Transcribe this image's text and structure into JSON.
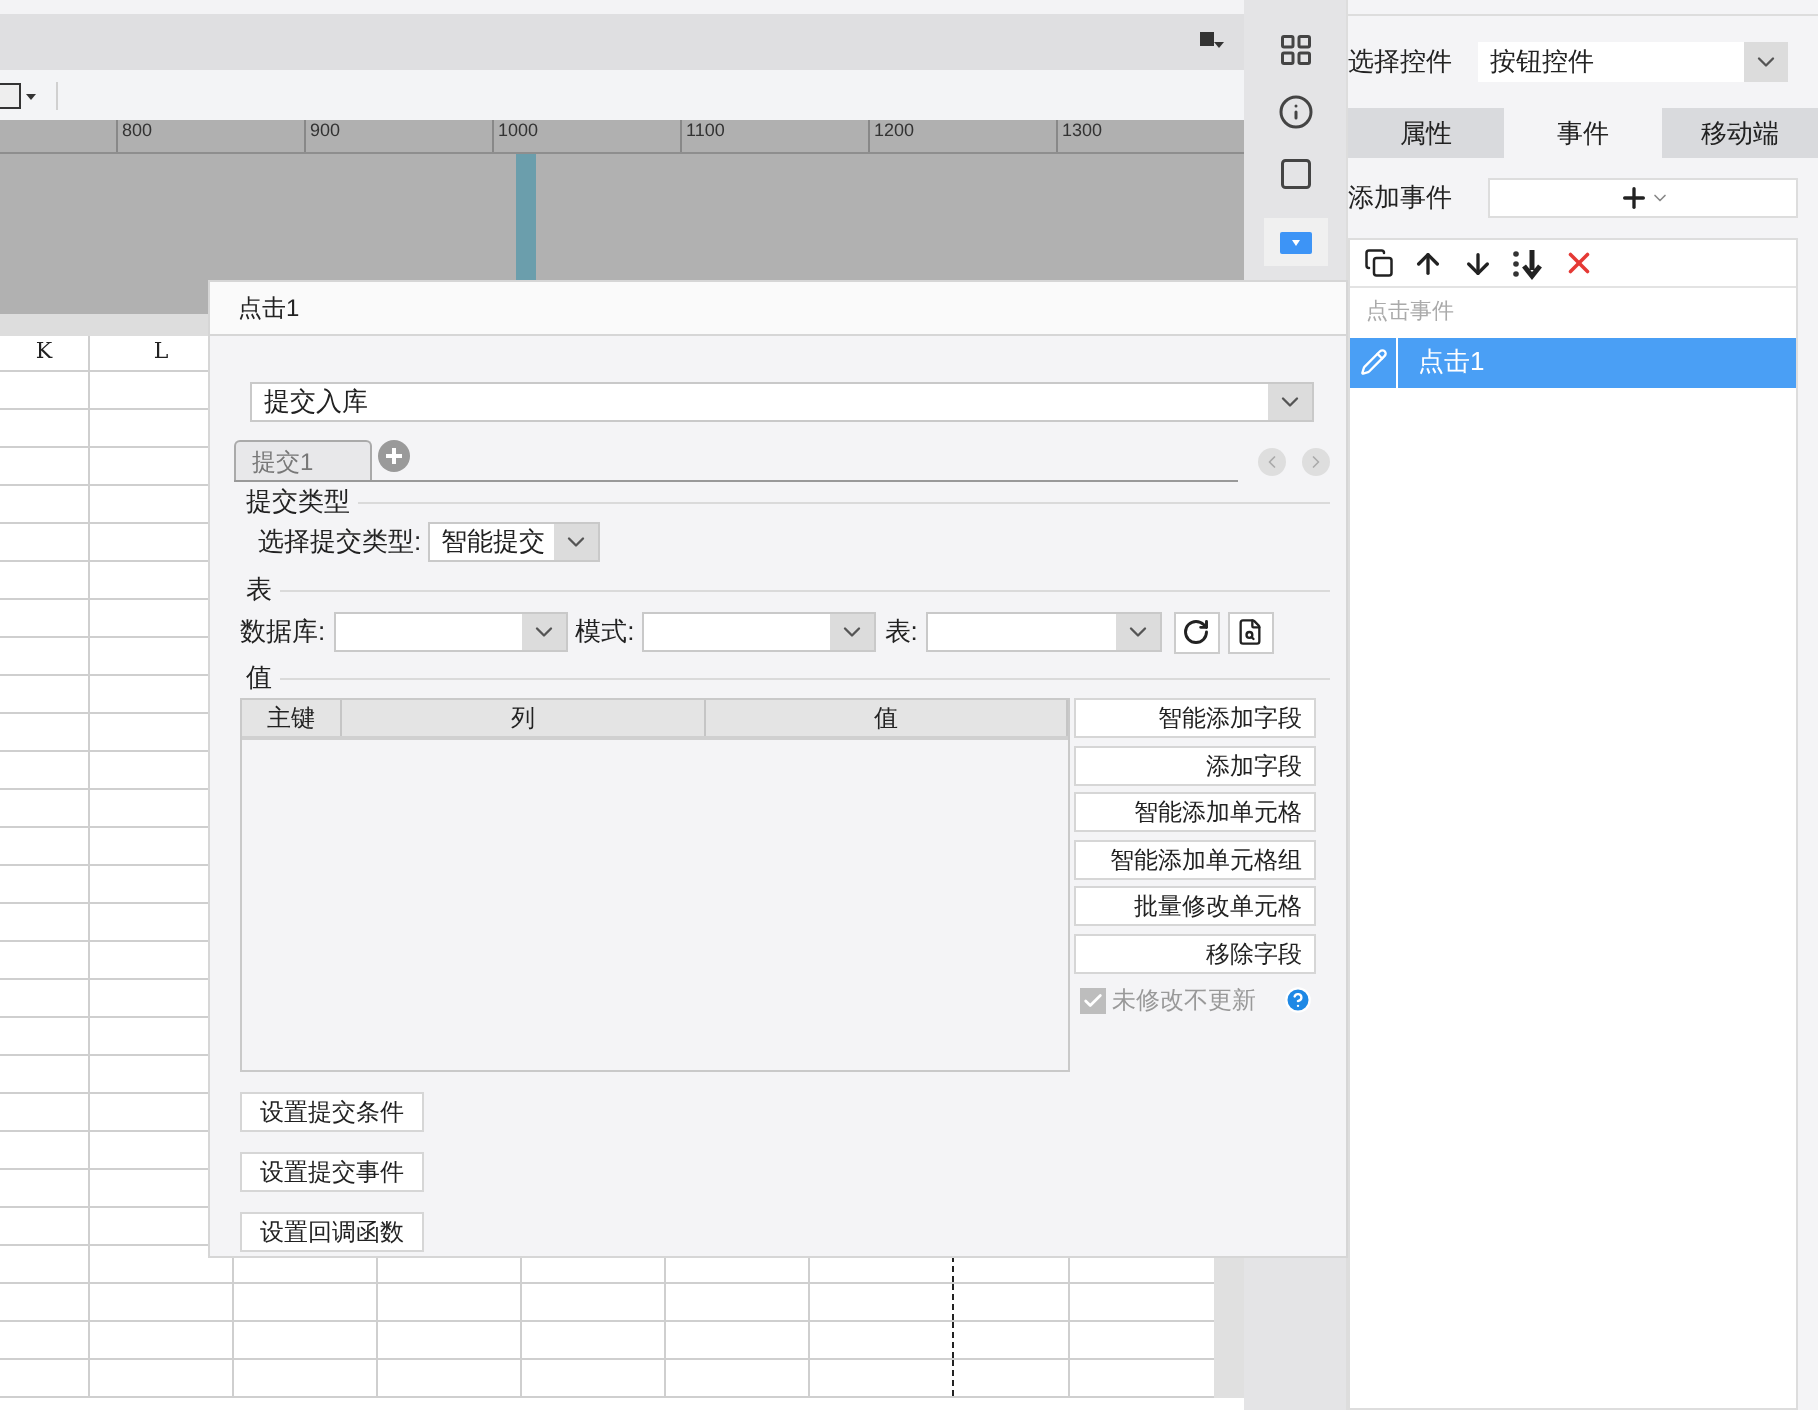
{
  "ruler": {
    "labels": [
      "800",
      "900",
      "1000",
      "1100",
      "1200",
      "1300"
    ]
  },
  "sheet": {
    "columns": [
      "K",
      "L"
    ]
  },
  "right_panel": {
    "control_select": {
      "label": "选择控件",
      "value": "按钮控件"
    },
    "tabs": [
      {
        "label": "属性",
        "selected": false
      },
      {
        "label": "事件",
        "selected": true
      },
      {
        "label": "移动端",
        "selected": false
      }
    ],
    "add_event": {
      "label": "添加事件"
    },
    "event_list": {
      "header": "点击事件",
      "items": [
        {
          "label": "点击1",
          "selected": true
        }
      ]
    }
  },
  "dialog": {
    "title": "点击1",
    "action_select": {
      "value": "提交入库"
    },
    "tabs": [
      {
        "label": "提交1",
        "selected": true
      }
    ],
    "submit_type": {
      "heading": "提交类型",
      "label": "选择提交类型:",
      "value": "智能提交"
    },
    "table_section": {
      "heading": "表",
      "fields": [
        {
          "label": "数据库:"
        },
        {
          "label": "模式:"
        },
        {
          "label": "表:"
        }
      ]
    },
    "values": {
      "heading": "值",
      "columns": [
        "主键",
        "列",
        "值"
      ],
      "buttons": [
        "智能添加字段",
        "添加字段",
        "智能添加单元格",
        "智能添加单元格组",
        "批量修改单元格",
        "移除字段"
      ],
      "skip_unchanged": {
        "label": "未修改不更新",
        "checked": true,
        "disabled": true
      }
    },
    "bottom_buttons": [
      "设置提交条件",
      "设置提交事件",
      "设置回调函数"
    ]
  }
}
